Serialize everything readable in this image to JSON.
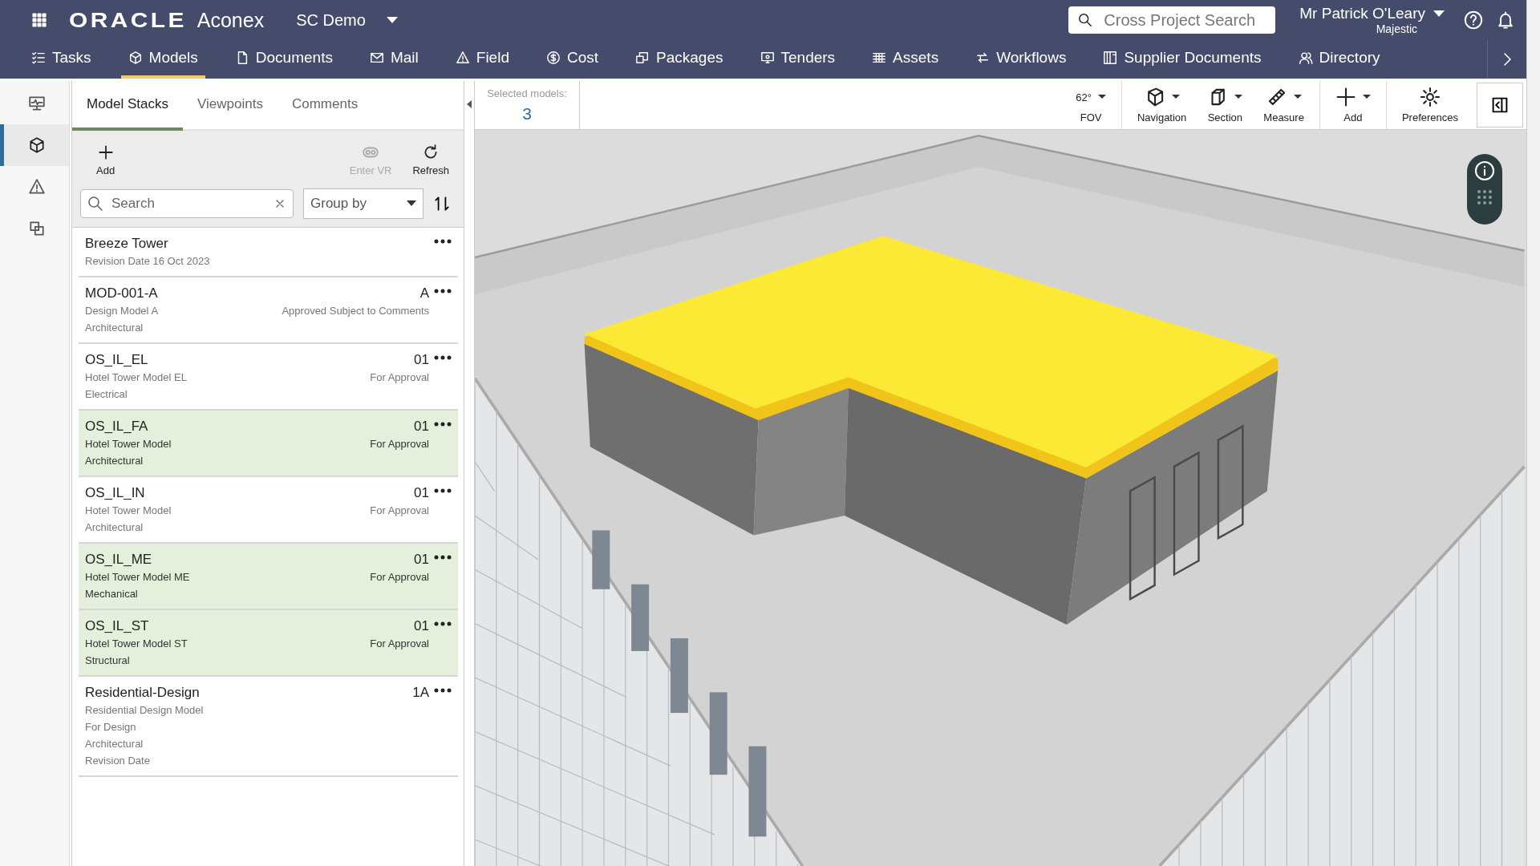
{
  "app": {
    "brand": "ORACLE",
    "product": "Aconex",
    "project": "SC Demo",
    "search": {
      "placeholder": "Cross Project Search"
    },
    "user": {
      "name": "Mr Patrick O'Leary",
      "org": "Majestic"
    }
  },
  "nav": [
    {
      "label": "Tasks",
      "selected": false
    },
    {
      "label": "Models",
      "selected": true
    },
    {
      "label": "Documents",
      "selected": false
    },
    {
      "label": "Mail",
      "selected": false
    },
    {
      "label": "Field",
      "selected": false
    },
    {
      "label": "Cost",
      "selected": false
    },
    {
      "label": "Packages",
      "selected": false
    },
    {
      "label": "Tenders",
      "selected": false
    },
    {
      "label": "Assets",
      "selected": false
    },
    {
      "label": "Workflows",
      "selected": false
    },
    {
      "label": "Supplier Documents",
      "selected": false
    },
    {
      "label": "Directory",
      "selected": false
    }
  ],
  "rail": [
    {
      "selected": false
    },
    {
      "selected": true
    },
    {
      "selected": false
    },
    {
      "selected": false
    }
  ],
  "panel": {
    "tabs": [
      {
        "label": "Model Stacks",
        "selected": true
      },
      {
        "label": "Viewpoints",
        "selected": false
      },
      {
        "label": "Comments",
        "selected": false
      }
    ],
    "actions": [
      {
        "label": "Add",
        "disabled": false
      },
      {
        "label": "Enter VR",
        "disabled": true
      },
      {
        "label": "Refresh",
        "disabled": false
      }
    ],
    "search": {
      "placeholder": "Search"
    },
    "group_by": {
      "placeholder": "Group by"
    },
    "models": [
      {
        "name": "Breeze Tower",
        "description": "Revision Date 16 Oct 2023",
        "selected": false
      },
      {
        "name": "MOD-001-A",
        "revision": "A",
        "description": "Design Model A",
        "status": "Approved Subject to Comments",
        "lines": [
          "Architectural"
        ],
        "selected": false
      },
      {
        "name": "OS_IL_EL",
        "revision": "01",
        "description": "Hotel Tower Model EL",
        "status": "For Approval",
        "lines": [
          "Electrical"
        ],
        "selected": false
      },
      {
        "name": "OS_IL_FA",
        "revision": "01",
        "description": "Hotel Tower Model",
        "status": "For Approval",
        "lines": [
          "Architectural"
        ],
        "selected": true
      },
      {
        "name": "OS_IL_IN",
        "revision": "01",
        "description": "Hotel Tower Model",
        "status": "For Approval",
        "lines": [
          "Architectural"
        ],
        "selected": false
      },
      {
        "name": "OS_IL_ME",
        "revision": "01",
        "description": "Hotel Tower Model ME",
        "status": "For Approval",
        "lines": [
          "Mechanical"
        ],
        "selected": true
      },
      {
        "name": "OS_IL_ST",
        "revision": "01",
        "description": "Hotel Tower Model ST",
        "status": "For Approval",
        "lines": [
          "Structural"
        ],
        "selected": true
      },
      {
        "name": "Residential-Design",
        "revision": "1A",
        "description": "Residential Design Model",
        "lines": [
          "For Design",
          "Architectural",
          "Revision Date"
        ],
        "selected": false
      }
    ]
  },
  "viewer": {
    "selected_label": "Selected models:",
    "selected_count": "3",
    "tools": [
      {
        "kind": "value",
        "value": "62°",
        "label": "FOV"
      },
      {
        "kind": "icon",
        "label": "Navigation"
      },
      {
        "kind": "icon",
        "label": "Section"
      },
      {
        "kind": "icon",
        "label": "Measure"
      },
      {
        "kind": "icon",
        "label": "Add"
      },
      {
        "kind": "plain",
        "label": "Preferences"
      }
    ]
  }
}
